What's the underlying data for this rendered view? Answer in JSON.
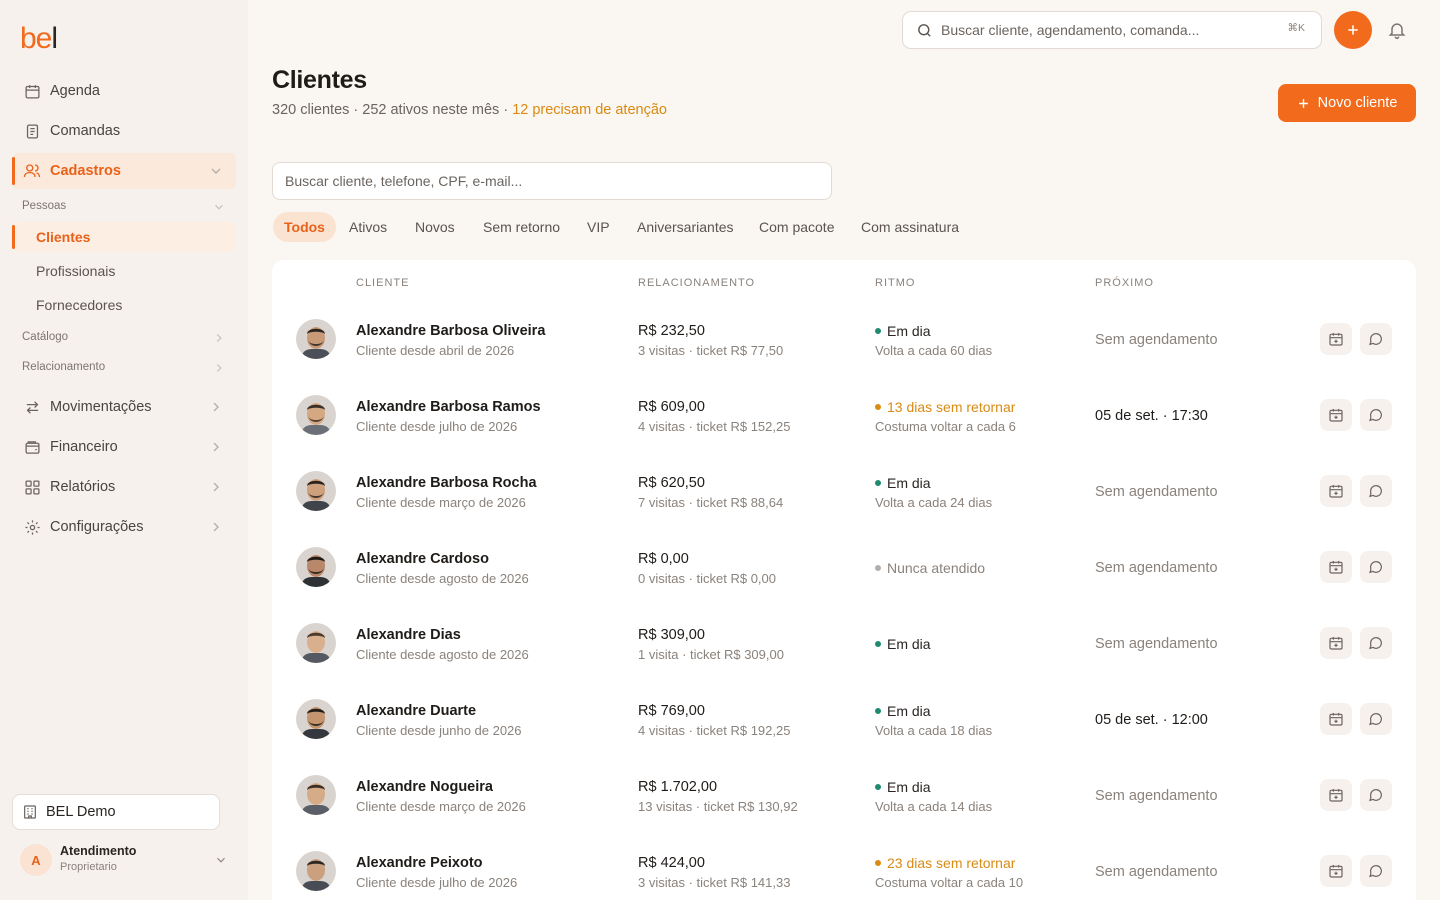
{
  "brand": {
    "logo_text_a": "be",
    "logo_text_b": "l"
  },
  "colors": {
    "accent": "#f26a1b",
    "warn": "#d98a12",
    "ok": "#1f8a70",
    "muted": "#b5aea8"
  },
  "sidebar": {
    "items": [
      {
        "label": "Agenda",
        "icon": "calendar-icon"
      },
      {
        "label": "Comandas",
        "icon": "receipt-icon"
      },
      {
        "label": "Cadastros",
        "icon": "users-icon",
        "active": true
      }
    ],
    "group_pessoas": "Pessoas",
    "sub_items": [
      {
        "label": "Clientes",
        "active": true
      },
      {
        "label": "Profissionais"
      },
      {
        "label": "Fornecedores"
      }
    ],
    "group_catalogo": "Catálogo",
    "group_relacionamento": "Relacionamento",
    "items_bottom": [
      {
        "label": "Movimentações",
        "icon": "arrows-icon"
      },
      {
        "label": "Financeiro",
        "icon": "wallet-icon"
      },
      {
        "label": "Relatórios",
        "icon": "grid-icon"
      },
      {
        "label": "Configurações",
        "icon": "gear-icon"
      }
    ],
    "org": "BEL Demo",
    "user": {
      "initial": "A",
      "name": "Atendimento",
      "role": "Proprietario"
    }
  },
  "topbar": {
    "search_placeholder": "Buscar cliente, agendamento, comanda...",
    "shortcut": "⌘K"
  },
  "header": {
    "title": "Clientes",
    "sub_main": "320 clientes · 252 ativos neste mês · ",
    "sub_warn": "12 precisam de atenção",
    "new_button": "Novo cliente"
  },
  "list_search_placeholder": "Buscar cliente, telefone, CPF, e-mail...",
  "tabs": [
    "Todos",
    "Ativos",
    "Novos",
    "Sem retorno",
    "VIP",
    "Aniversariantes",
    "Com pacote",
    "Com assinatura"
  ],
  "table": {
    "headers": {
      "cliente": "CLIENTE",
      "relacionamento": "RELACIONAMENTO",
      "ritmo": "RITMO",
      "proximo": "PRÓXIMO"
    },
    "rows": [
      {
        "name": "Alexandre Barbosa Oliveira",
        "since": "Cliente desde abril de 2026",
        "value": "R$ 232,50",
        "visits": "3 visitas · ticket R$ 77,50",
        "status": "Em dia",
        "status_kind": "ok",
        "cadence": "Volta a cada 60 dias",
        "next": "Sem agendamento",
        "has_next": false
      },
      {
        "name": "Alexandre Barbosa Ramos",
        "since": "Cliente desde julho de 2026",
        "value": "R$ 609,00",
        "visits": "4 visitas · ticket R$ 152,25",
        "status": "13 dias sem retornar",
        "status_kind": "warn",
        "cadence": "Costuma voltar a cada 6",
        "next": "05 de set. · 17:30",
        "has_next": true
      },
      {
        "name": "Alexandre Barbosa Rocha",
        "since": "Cliente desde março de 2026",
        "value": "R$ 620,50",
        "visits": "7 visitas · ticket R$ 88,64",
        "status": "Em dia",
        "status_kind": "ok",
        "cadence": "Volta a cada 24 dias",
        "next": "Sem agendamento",
        "has_next": false
      },
      {
        "name": "Alexandre Cardoso",
        "since": "Cliente desde agosto de 2026",
        "value": "R$ 0,00",
        "visits": "0 visitas · ticket R$ 0,00",
        "status": "Nunca atendido",
        "status_kind": "muted",
        "cadence": "",
        "next": "Sem agendamento",
        "has_next": false
      },
      {
        "name": "Alexandre Dias",
        "since": "Cliente desde agosto de 2026",
        "value": "R$ 309,00",
        "visits": "1 visita · ticket R$ 309,00",
        "status": "Em dia",
        "status_kind": "ok",
        "cadence": "",
        "next": "Sem agendamento",
        "has_next": false
      },
      {
        "name": "Alexandre Duarte",
        "since": "Cliente desde junho de 2026",
        "value": "R$ 769,00",
        "visits": "4 visitas · ticket R$ 192,25",
        "status": "Em dia",
        "status_kind": "ok",
        "cadence": "Volta a cada 18 dias",
        "next": "05 de set. · 12:00",
        "has_next": true
      },
      {
        "name": "Alexandre Nogueira",
        "since": "Cliente desde março de 2026",
        "value": "R$ 1.702,00",
        "visits": "13 visitas · ticket R$ 130,92",
        "status": "Em dia",
        "status_kind": "ok",
        "cadence": "Volta a cada 14 dias",
        "next": "Sem agendamento",
        "has_next": false
      },
      {
        "name": "Alexandre Peixoto",
        "since": "Cliente desde julho de 2026",
        "value": "R$ 424,00",
        "visits": "3 visitas · ticket R$ 141,33",
        "status": "23 dias sem retornar",
        "status_kind": "warn",
        "cadence": "Costuma voltar a cada 10",
        "next": "Sem agendamento",
        "has_next": false
      }
    ]
  }
}
